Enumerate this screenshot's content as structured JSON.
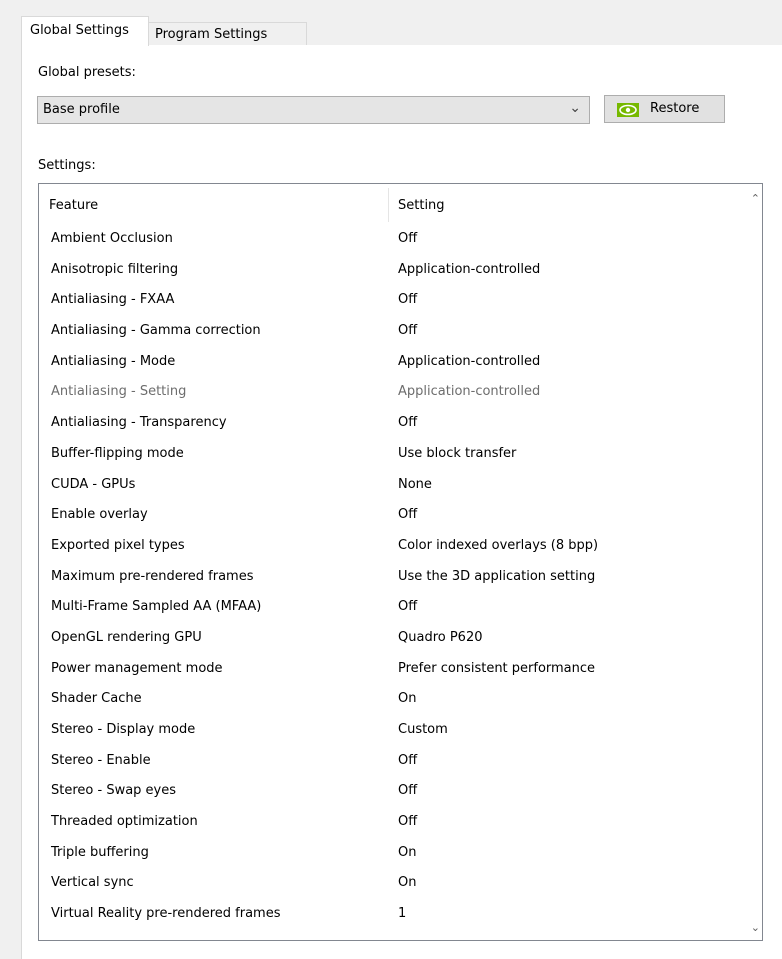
{
  "tabs": [
    {
      "label": "Global Settings",
      "active": true
    },
    {
      "label": "Program Settings",
      "active": false
    }
  ],
  "global_presets": {
    "label": "Global presets:",
    "selected": "Base profile",
    "restore_label": "Restore"
  },
  "settings": {
    "label": "Settings:",
    "columns": [
      "Feature",
      "Setting"
    ],
    "rows": [
      {
        "feature": "Ambient Occlusion",
        "setting": "Off"
      },
      {
        "feature": "Anisotropic filtering",
        "setting": "Application-controlled"
      },
      {
        "feature": "Antialiasing - FXAA",
        "setting": "Off"
      },
      {
        "feature": "Antialiasing - Gamma correction",
        "setting": "Off"
      },
      {
        "feature": "Antialiasing - Mode",
        "setting": "Application-controlled"
      },
      {
        "feature": "Antialiasing - Setting",
        "setting": "Application-controlled",
        "disabled": true
      },
      {
        "feature": "Antialiasing - Transparency",
        "setting": "Off"
      },
      {
        "feature": "Buffer-flipping mode",
        "setting": "Use block transfer"
      },
      {
        "feature": "CUDA - GPUs",
        "setting": "None"
      },
      {
        "feature": "Enable overlay",
        "setting": "Off"
      },
      {
        "feature": "Exported pixel types",
        "setting": "Color indexed overlays (8 bpp)"
      },
      {
        "feature": "Maximum pre-rendered frames",
        "setting": "Use the 3D application setting"
      },
      {
        "feature": "Multi-Frame Sampled AA (MFAA)",
        "setting": "Off"
      },
      {
        "feature": "OpenGL rendering GPU",
        "setting": "Quadro P620"
      },
      {
        "feature": "Power management mode",
        "setting": "Prefer consistent performance"
      },
      {
        "feature": "Shader Cache",
        "setting": "On"
      },
      {
        "feature": "Stereo - Display mode",
        "setting": "Custom"
      },
      {
        "feature": "Stereo - Enable",
        "setting": "Off"
      },
      {
        "feature": "Stereo - Swap eyes",
        "setting": "Off"
      },
      {
        "feature": "Threaded optimization",
        "setting": "Off"
      },
      {
        "feature": "Triple buffering",
        "setting": "On"
      },
      {
        "feature": "Vertical sync",
        "setting": "On"
      },
      {
        "feature": "Virtual Reality pre-rendered frames",
        "setting": "1"
      }
    ]
  },
  "icons": {
    "restore": "nvidia-eye-icon",
    "dropdown": "chevron-down-icon",
    "scroll_up": "scroll-up-arrow-icon",
    "scroll_down": "scroll-down-arrow-icon"
  },
  "colors": {
    "nvidia_green": "#76b900",
    "disabled_text": "#6d6d6d"
  }
}
